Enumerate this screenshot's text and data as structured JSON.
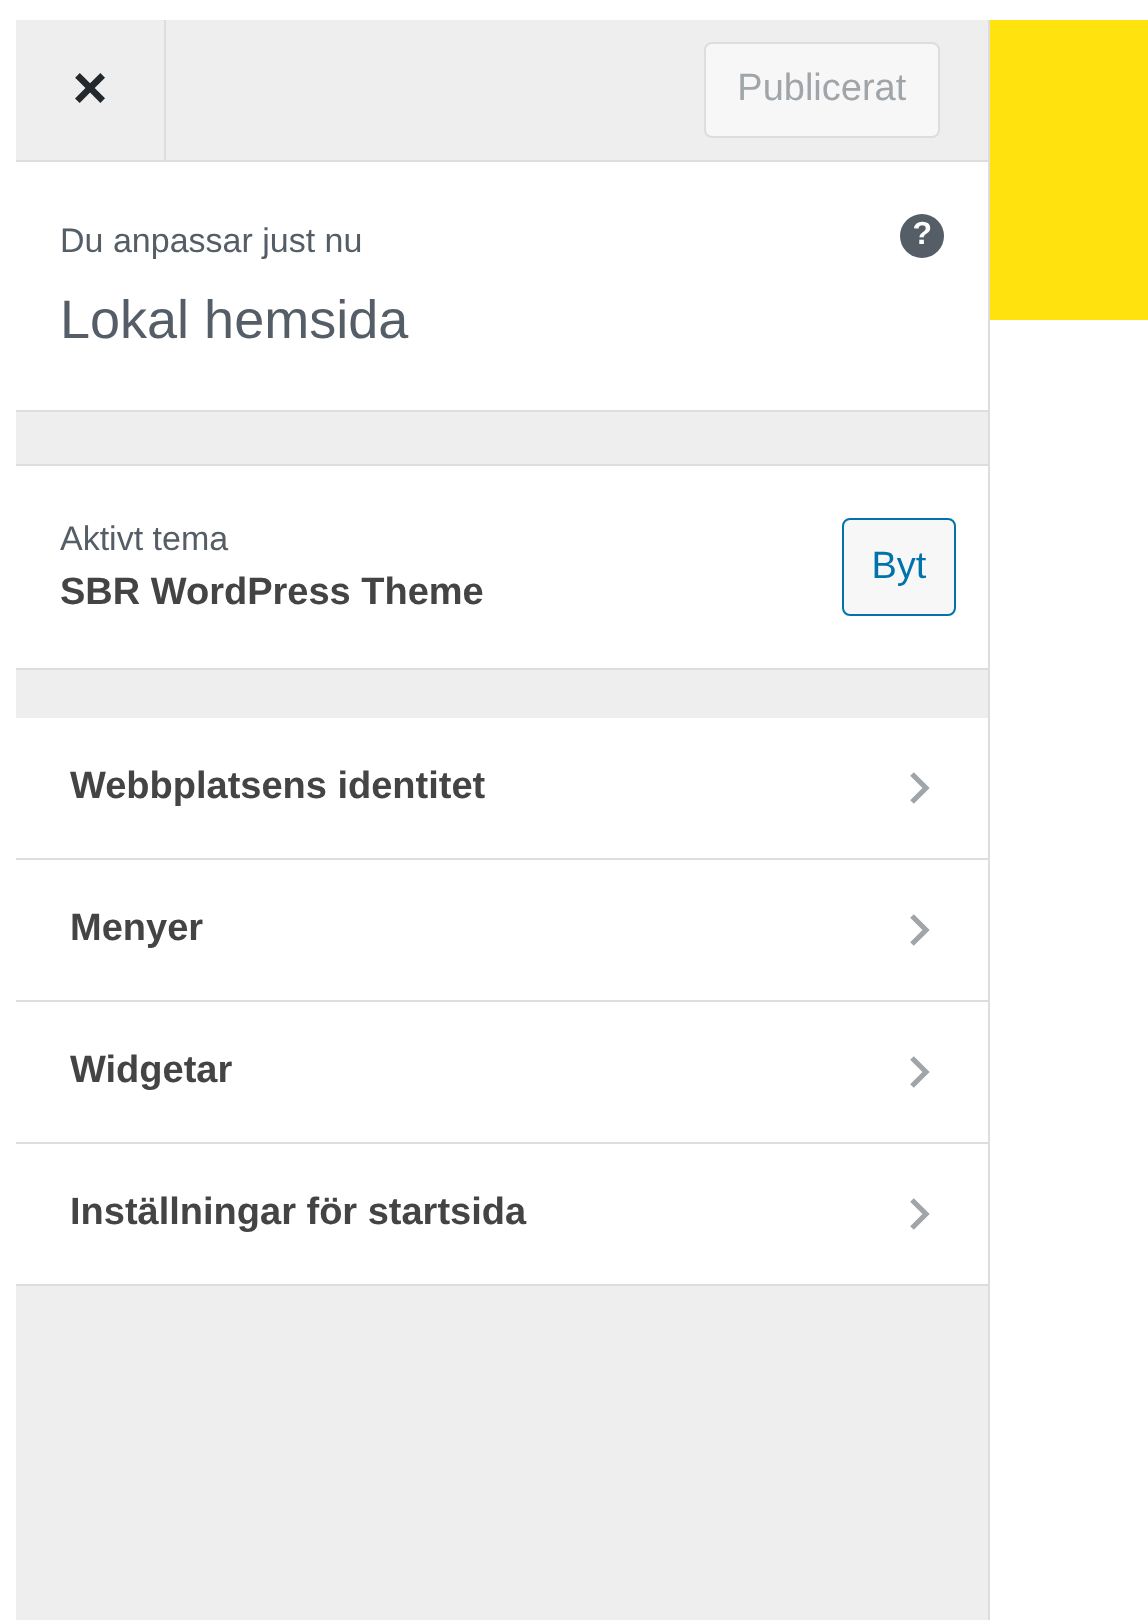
{
  "header": {
    "close_label": "×",
    "publish_button": {
      "label": "Publicerat",
      "disabled": true
    }
  },
  "info": {
    "caption": "Du anpassar just nu",
    "title": "Lokal hemsida",
    "help": "?"
  },
  "theme": {
    "caption": "Aktivt tema",
    "name": "SBR WordPress Theme",
    "button": "Byt"
  },
  "sections": [
    {
      "label": "Webbplatsens identitet"
    },
    {
      "label": "Menyer"
    },
    {
      "label": "Widgetar"
    },
    {
      "label": "Inställningar för startsida"
    }
  ]
}
